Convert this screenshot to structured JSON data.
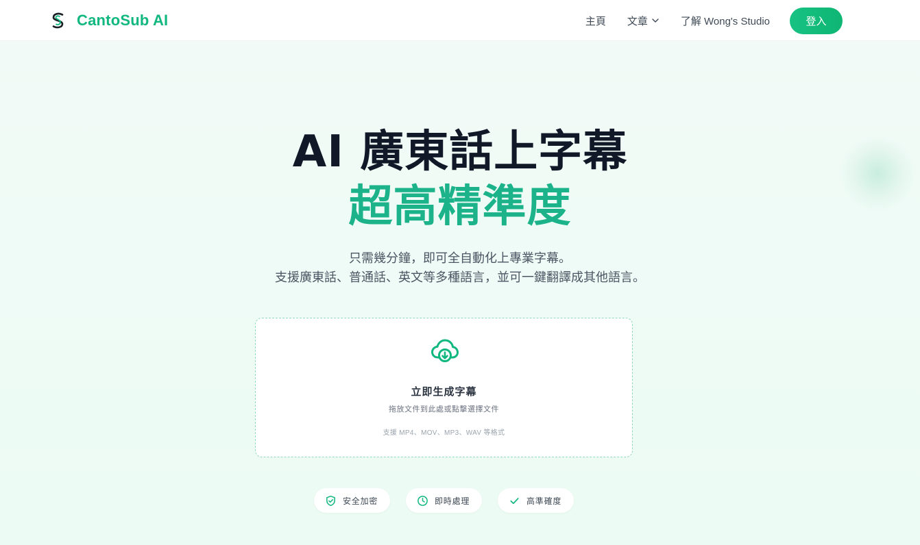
{
  "header": {
    "brand": "CantoSub AI",
    "nav": {
      "home": "主頁",
      "articles": "文章",
      "about": "了解 Wong's Studio"
    },
    "login_label": "登入"
  },
  "hero": {
    "title_line1": "AI 廣東話上字幕",
    "title_line2": "超高精準度",
    "subtitle_line1": "只需幾分鐘，即可全自動化上專業字幕。",
    "subtitle_line2": "支援廣東話、普通話、英文等多種語言，並可一鍵翻譯成其他語言。"
  },
  "upload": {
    "icon": "cloud-download-icon",
    "title": "立即生成字幕",
    "hint": "拖放文件到此處或點擊選擇文件",
    "formats": "支援 MP4、MOV、MP3、WAV 等格式"
  },
  "features": [
    {
      "icon": "shield-check-icon",
      "label": "安全加密"
    },
    {
      "icon": "clock-icon",
      "label": "即時處理"
    },
    {
      "icon": "check-icon",
      "label": "高準確度"
    }
  ],
  "colors": {
    "brand_green": "#10b77f",
    "accent_green": "#1cb38a",
    "title_dark": "#111827"
  }
}
